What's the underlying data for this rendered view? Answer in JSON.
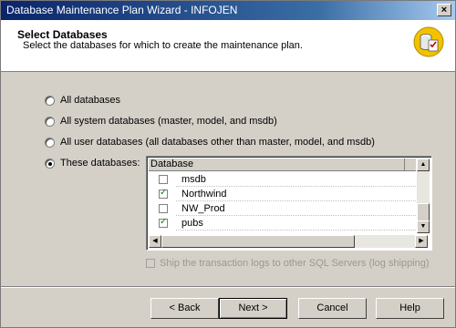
{
  "window": {
    "title": "Database Maintenance Plan Wizard - INFOJEN",
    "close_glyph": "×"
  },
  "header": {
    "title": "Select Databases",
    "subtitle": "Select the databases for which to create the maintenance plan."
  },
  "options": [
    {
      "label": "All databases",
      "selected": false
    },
    {
      "label": "All system databases (master, model, and msdb)",
      "selected": false
    },
    {
      "label": "All user databases (all databases other than master, model, and msdb)",
      "selected": false
    },
    {
      "label": "These databases:",
      "selected": true
    }
  ],
  "grid": {
    "column": "Database",
    "rows": [
      {
        "name": "msdb",
        "checked": false
      },
      {
        "name": "Northwind",
        "checked": true
      },
      {
        "name": "NW_Prod",
        "checked": false
      },
      {
        "name": "pubs",
        "checked": true
      }
    ]
  },
  "log_shipping": {
    "label": "Ship the transaction logs to other SQL Servers (log shipping)",
    "checked": false,
    "enabled": false
  },
  "buttons": {
    "back": "< Back",
    "next": "Next >",
    "cancel": "Cancel",
    "help": "Help"
  },
  "icons": {
    "wizard": "database-wizard-icon",
    "scroll_up": "▲",
    "scroll_down": "▼",
    "scroll_left": "◀",
    "scroll_right": "▶"
  }
}
